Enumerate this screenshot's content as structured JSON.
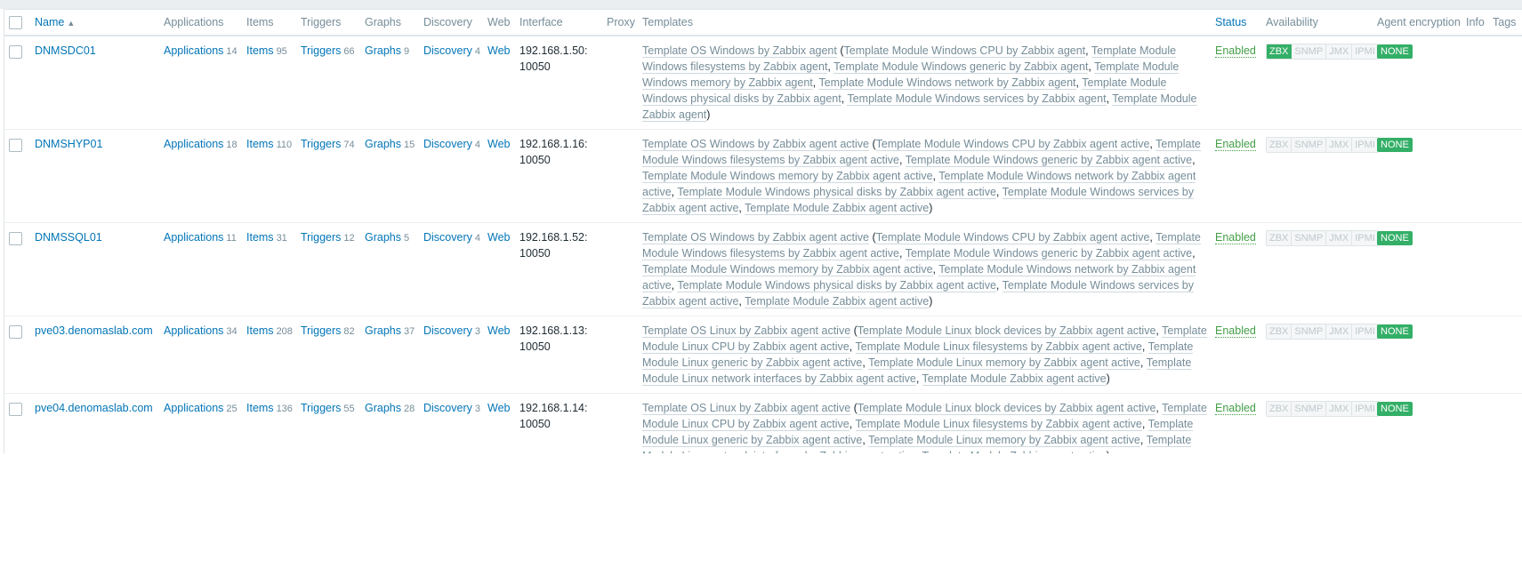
{
  "header": {
    "name": "Name",
    "applications": "Applications",
    "items": "Items",
    "triggers": "Triggers",
    "graphs": "Graphs",
    "discovery": "Discovery",
    "web": "Web",
    "interface": "Interface",
    "proxy": "Proxy",
    "templates": "Templates",
    "status": "Status",
    "availability": "Availability",
    "agent_encryption": "Agent encryption",
    "info": "Info",
    "tags": "Tags",
    "sort_icon": "triangle-up"
  },
  "labels": {
    "applications": "Applications",
    "items": "Items",
    "triggers": "Triggers",
    "graphs": "Graphs",
    "discovery": "Discovery",
    "web": "Web",
    "avail": [
      "ZBX",
      "SNMP",
      "JMX",
      "IPMI"
    ]
  },
  "colors": {
    "link": "#0275b8",
    "enabled": "#429e47",
    "badge_green": "#34af67",
    "muted": "#768d99"
  },
  "hosts": [
    {
      "name": "DNMSDC01",
      "applications": "14",
      "items": "95",
      "triggers": "66",
      "graphs": "9",
      "discovery": "4",
      "interface_ip": "192.168.1.50:",
      "interface_port": "10050",
      "template": "Template OS Windows by Zabbix agent",
      "children": [
        "Template Module Windows CPU by Zabbix agent",
        "Template Module Windows filesystems by Zabbix agent",
        "Template Module Windows generic by Zabbix agent",
        "Template Module Windows memory by Zabbix agent",
        "Template Module Windows network by Zabbix agent",
        "Template Module Windows physical disks by Zabbix agent",
        "Template Module Windows services by Zabbix agent",
        "Template Module Zabbix agent"
      ],
      "status": "Enabled",
      "zbx_available": true,
      "encryption": "NONE"
    },
    {
      "name": "DNMSHYP01",
      "applications": "18",
      "items": "110",
      "triggers": "74",
      "graphs": "15",
      "discovery": "4",
      "interface_ip": "192.168.1.16:",
      "interface_port": "10050",
      "template": "Template OS Windows by Zabbix agent active",
      "children": [
        "Template Module Windows CPU by Zabbix agent active",
        "Template Module Windows filesystems by Zabbix agent active",
        "Template Module Windows generic by Zabbix agent active",
        "Template Module Windows memory by Zabbix agent active",
        "Template Module Windows network by Zabbix agent active",
        "Template Module Windows physical disks by Zabbix agent active",
        "Template Module Windows services by Zabbix agent active",
        "Template Module Zabbix agent active"
      ],
      "status": "Enabled",
      "zbx_available": false,
      "encryption": "NONE"
    },
    {
      "name": "DNMSSQL01",
      "applications": "11",
      "items": "31",
      "triggers": "12",
      "graphs": "5",
      "discovery": "4",
      "interface_ip": "192.168.1.52:",
      "interface_port": "10050",
      "template": "Template OS Windows by Zabbix agent active",
      "children": [
        "Template Module Windows CPU by Zabbix agent active",
        "Template Module Windows filesystems by Zabbix agent active",
        "Template Module Windows generic by Zabbix agent active",
        "Template Module Windows memory by Zabbix agent active",
        "Template Module Windows network by Zabbix agent active",
        "Template Module Windows physical disks by Zabbix agent active",
        "Template Module Windows services by Zabbix agent active",
        "Template Module Zabbix agent active"
      ],
      "status": "Enabled",
      "zbx_available": false,
      "encryption": "NONE"
    },
    {
      "name": "pve03.denomaslab.com",
      "applications": "34",
      "items": "208",
      "triggers": "82",
      "graphs": "37",
      "discovery": "3",
      "interface_ip": "192.168.1.13:",
      "interface_port": "10050",
      "template": "Template OS Linux by Zabbix agent active",
      "children": [
        "Template Module Linux block devices by Zabbix agent active",
        "Template Module Linux CPU by Zabbix agent active",
        "Template Module Linux filesystems by Zabbix agent active",
        "Template Module Linux generic by Zabbix agent active",
        "Template Module Linux memory by Zabbix agent active",
        "Template Module Linux network interfaces by Zabbix agent active",
        "Template Module Zabbix agent active"
      ],
      "status": "Enabled",
      "zbx_available": false,
      "encryption": "NONE"
    },
    {
      "name": "pve04.denomaslab.com",
      "applications": "25",
      "items": "136",
      "triggers": "55",
      "graphs": "28",
      "discovery": "3",
      "interface_ip": "192.168.1.14:",
      "interface_port": "10050",
      "template": "Template OS Linux by Zabbix agent active",
      "children": [
        "Template Module Linux block devices by Zabbix agent active",
        "Template Module Linux CPU by Zabbix agent active",
        "Template Module Linux filesystems by Zabbix agent active",
        "Template Module Linux generic by Zabbix agent active",
        "Template Module Linux memory by Zabbix agent active",
        "Template Module Linux network interfaces by Zabbix agent active",
        "Template Module Zabbix agent active"
      ],
      "status": "Enabled",
      "zbx_available": false,
      "encryption": "NONE"
    }
  ]
}
